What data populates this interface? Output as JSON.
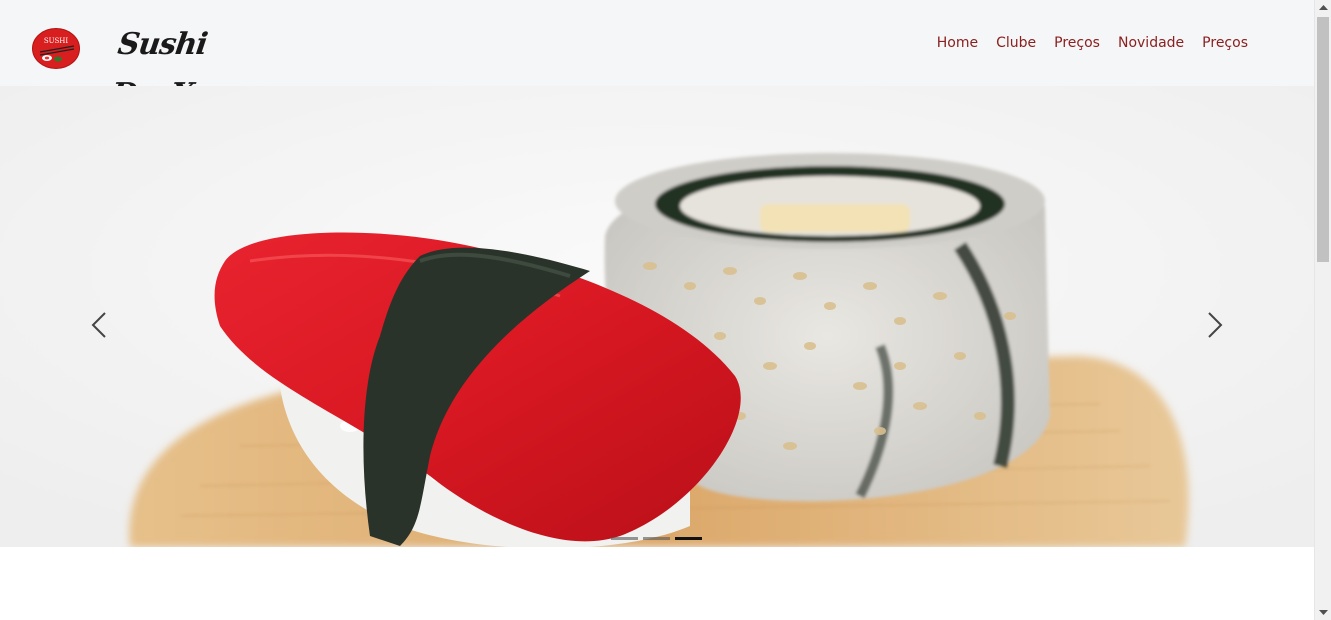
{
  "brand": {
    "name": "Sushi DevX",
    "logo_text": "SUSHI"
  },
  "nav": {
    "items": [
      "Home",
      "Clube",
      "Preços",
      "Novidade",
      "Preços"
    ]
  },
  "carousel": {
    "slide_count": 3,
    "active_index": 2,
    "prev_icon": "chevron-left-icon",
    "next_icon": "chevron-right-icon"
  },
  "colors": {
    "nav_link": "#8b2020",
    "navbar_bg": "#f5f6f7",
    "logo_red": "#d81e1e"
  }
}
